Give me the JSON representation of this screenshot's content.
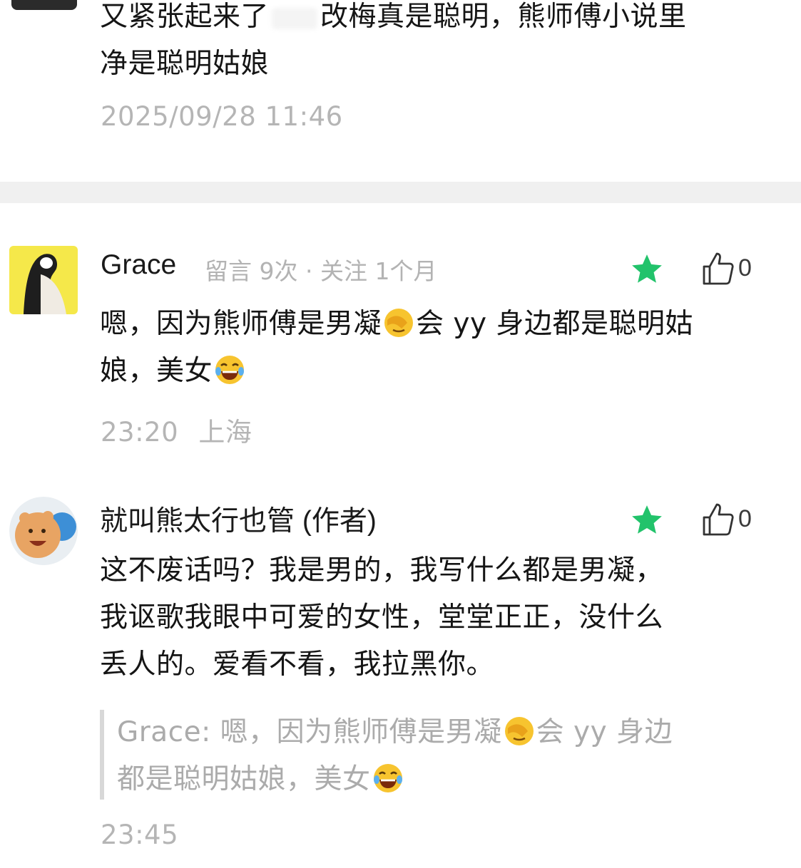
{
  "comment_prev": {
    "text_line1a": "又紧张起来了",
    "text_line1b": "改梅真是聪明，熊师傅小说里",
    "text_line2": "净是聪明姑娘",
    "timestamp": "2025/09/28 11:46"
  },
  "comment_grace": {
    "name": "Grace",
    "meta": "留言 9次 · 关注 1个月",
    "like_count": "0",
    "text_a": "嗯，因为熊师傅是男凝",
    "text_b": "会 yy 身边都是聪明姑",
    "text_c": "娘，美女",
    "time": "23:20",
    "location": "上海"
  },
  "comment_author": {
    "name": "就叫熊太行也管 (作者)",
    "like_count": "0",
    "line1": "这不废话吗？我是男的，我写什么都是男凝，",
    "line2": "我讴歌我眼中可爱的女性，堂堂正正，没什么",
    "line3": "丢人的。爱看不看，我拉黑你。",
    "quote_a": "Grace: 嗯，因为熊师傅是男凝",
    "quote_b": "会 yy 身边",
    "quote_c": "都是聪明姑娘，美女",
    "time": "23:45"
  },
  "colors": {
    "star": "#22c36b",
    "meta_gray": "#b5b5b5",
    "divider": "#f0f0f0"
  },
  "icons": [
    "star-icon",
    "thumbs-up-icon",
    "facepalm-emoji",
    "laughing-emoji"
  ]
}
